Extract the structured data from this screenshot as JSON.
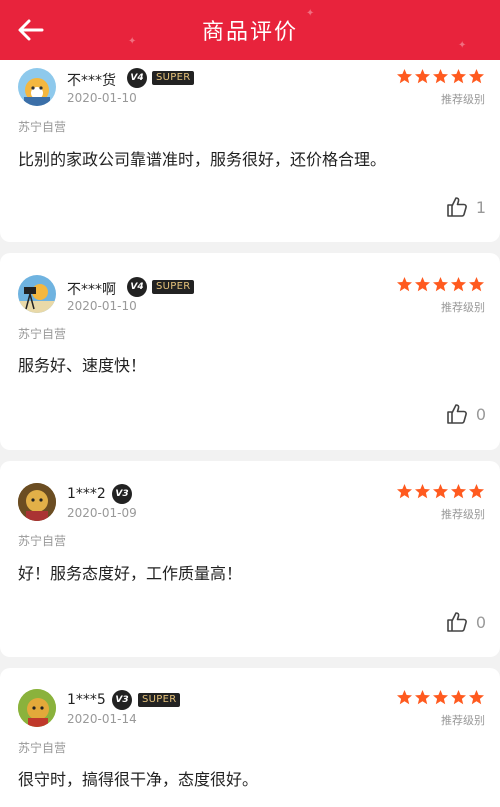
{
  "header": {
    "title": "商品评价",
    "back_icon": "arrow-left-icon"
  },
  "colors": {
    "header_bg": "#e8233c",
    "star": "#ff5a1f",
    "super_text": "#e6c27a"
  },
  "reviews": [
    {
      "user": "不***货",
      "vip": "V4",
      "super": "SUPER",
      "date": "2020-01-10",
      "rating": 5,
      "rating_label": "推荐级别",
      "seller": "苏宁自营",
      "text": "比别的家政公司靠谱准时，服务很好，还价格合理。",
      "likes": "1"
    },
    {
      "user": "不***啊",
      "vip": "V4",
      "super": "SUPER",
      "date": "2020-01-10",
      "rating": 5,
      "rating_label": "推荐级别",
      "seller": "苏宁自营",
      "text": "服务好、速度快！",
      "likes": "0"
    },
    {
      "user": "1***2",
      "vip": "V3",
      "super": "",
      "date": "2020-01-09",
      "rating": 5,
      "rating_label": "推荐级别",
      "seller": "苏宁自营",
      "text": "好！服务态度好，工作质量高！",
      "likes": "0"
    },
    {
      "user": "1***5",
      "vip": "V3",
      "super": "SUPER",
      "date": "2020-01-14",
      "rating": 5,
      "rating_label": "推荐级别",
      "seller": "苏宁自营",
      "text": "很守时，搞得很干净，态度很好。",
      "likes": ""
    }
  ]
}
